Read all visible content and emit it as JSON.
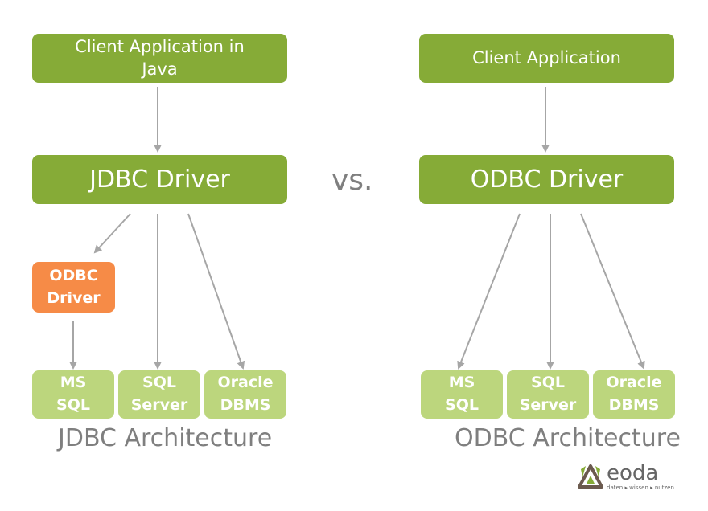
{
  "colors": {
    "dark_green": "#86ab37",
    "light_green": "#bcd67d",
    "orange": "#f68b47",
    "arrow_gray": "#a6a6a6",
    "caption_gray": "#7f7f7f"
  },
  "jdbc": {
    "client": "Client Application in Java",
    "driver": "JDBC Driver",
    "odbc_bridge": "ODBC Driver",
    "db1": "MS SQL",
    "db2": "SQL Server",
    "db3": "Oracle DBMS",
    "caption": "JDBC Architecture"
  },
  "vs_label": "vs.",
  "odbc": {
    "client": "Client Application",
    "driver": "ODBC Driver",
    "db1": "MS SQL",
    "db2": "SQL Server",
    "db3": "Oracle DBMS",
    "caption": "ODBC Architecture"
  },
  "logo": {
    "name": "eoda",
    "tagline": "daten ▸ wissen ▸ nutzen"
  }
}
